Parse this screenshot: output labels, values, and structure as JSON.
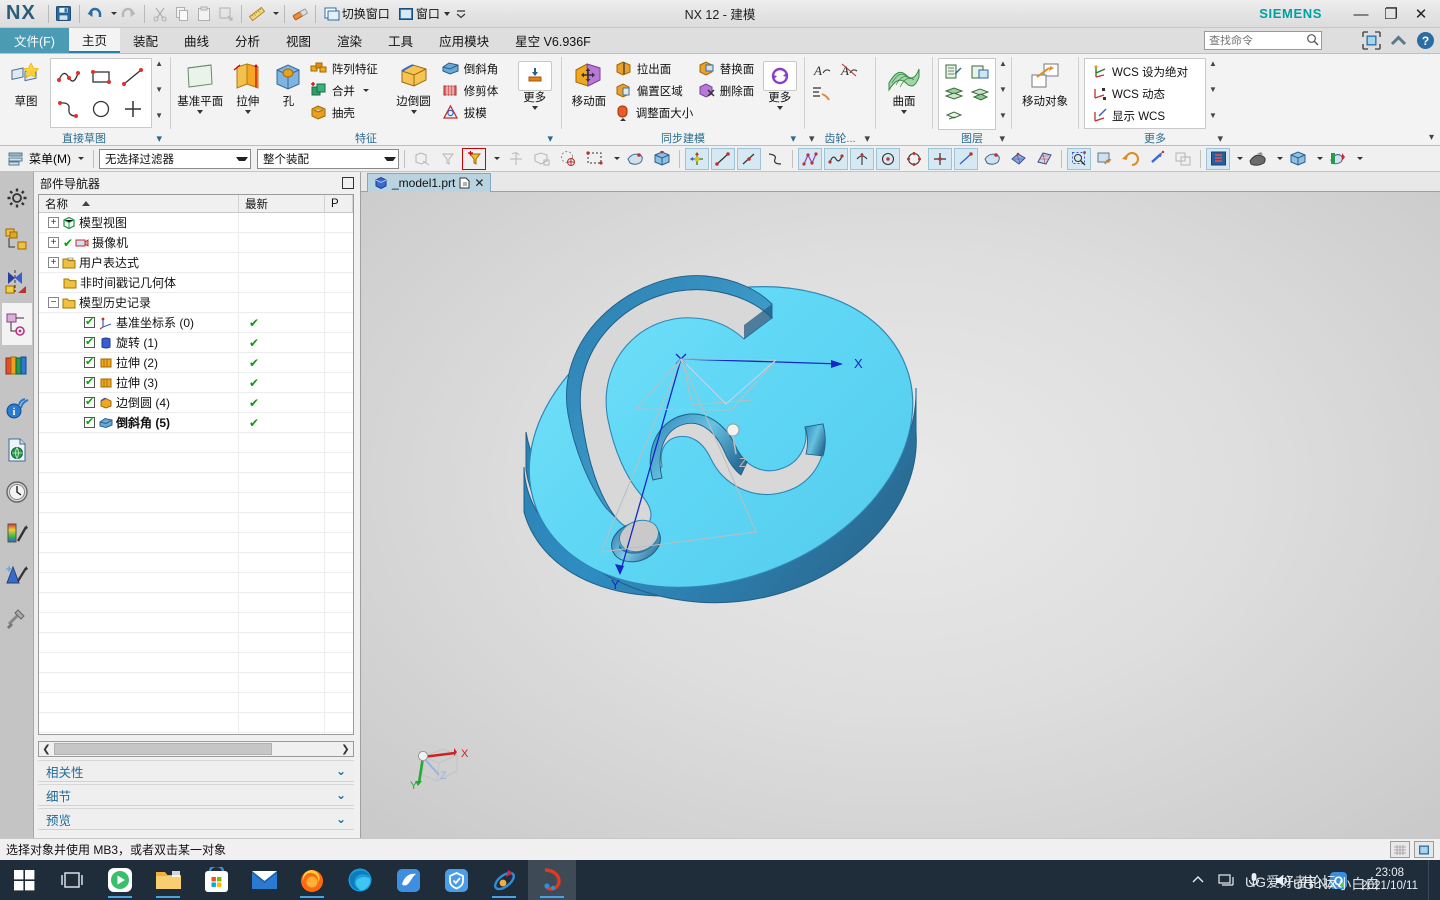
{
  "window": {
    "app_name": "NX",
    "title": "NX 12 - 建模",
    "brand": "SIEMENS",
    "minimize": "—",
    "restore": "❐",
    "close": "✕"
  },
  "quick_access": {
    "items": [
      {
        "name": "save-icon",
        "label": ""
      },
      {
        "name": "undo-icon",
        "label": ""
      },
      {
        "name": "redo-icon",
        "label": ""
      },
      {
        "name": "cut-icon",
        "label": ""
      },
      {
        "name": "copy-icon",
        "label": ""
      },
      {
        "name": "paste-icon",
        "label": ""
      },
      {
        "name": "paste-special-icon",
        "label": ""
      },
      {
        "name": "measure-icon",
        "label": ""
      },
      {
        "name": "eraser-icon",
        "label": ""
      }
    ],
    "switch_window": "切换窗口",
    "window_menu": "窗口"
  },
  "ribbon_tabs": [
    {
      "label": "文件(F)",
      "id": "file"
    },
    {
      "label": "主页",
      "id": "home"
    },
    {
      "label": "装配",
      "id": "assembly"
    },
    {
      "label": "曲线",
      "id": "curve"
    },
    {
      "label": "分析",
      "id": "analysis"
    },
    {
      "label": "视图",
      "id": "view"
    },
    {
      "label": "渲染",
      "id": "render"
    },
    {
      "label": "工具",
      "id": "tools"
    },
    {
      "label": "应用模块",
      "id": "applications"
    },
    {
      "label": "星空 V6.936F",
      "id": "xingkong"
    }
  ],
  "active_tab": "主页",
  "search": {
    "placeholder": "查找命令",
    "value": ""
  },
  "ribbon_groups": [
    {
      "name": "直接草图",
      "label": "直接草图",
      "big_buttons": [
        {
          "label": "草图",
          "icon": "sketch-icon"
        }
      ],
      "gallery": [
        "arc-icon",
        "rectangle-icon",
        "line-icon",
        "spline-icon",
        "circle-icon",
        "point-icon"
      ]
    },
    {
      "name": "特征",
      "label": "特征",
      "big_buttons": [
        {
          "label": "基准平面",
          "icon": "datum-plane-icon",
          "dropdown": true
        },
        {
          "label": "拉伸",
          "icon": "extrude-icon",
          "dropdown": true
        },
        {
          "label": "孔",
          "icon": "hole-icon",
          "dropdown": false
        },
        {
          "label": "边倒圆",
          "icon": "edge-blend-icon",
          "dropdown": true
        },
        {
          "label": "更多",
          "icon": "more-features-icon",
          "dropdown": true
        }
      ],
      "small_buttons": [
        {
          "label": "阵列特征",
          "icon": "pattern-feature-icon"
        },
        {
          "label": "合并",
          "icon": "unite-icon",
          "dropdown": true
        },
        {
          "label": "抽壳",
          "icon": "shell-icon"
        },
        {
          "label": "倒斜角",
          "icon": "chamfer-icon"
        },
        {
          "label": "修剪体",
          "icon": "trim-body-icon"
        },
        {
          "label": "拔模",
          "icon": "draft-icon"
        }
      ]
    },
    {
      "name": "同步建模",
      "label": "同步建模",
      "big_buttons": [
        {
          "label": "移动面",
          "icon": "move-face-icon"
        },
        {
          "label": "更多",
          "icon": "sync-more-icon",
          "dropdown": true
        }
      ],
      "small_buttons": [
        {
          "label": "拉出面",
          "icon": "pull-face-icon"
        },
        {
          "label": "偏置区域",
          "icon": "offset-region-icon"
        },
        {
          "label": "调整面大小",
          "icon": "resize-face-icon"
        },
        {
          "label": "替换面",
          "icon": "replace-face-icon"
        },
        {
          "label": "删除面",
          "icon": "delete-face-icon"
        }
      ]
    },
    {
      "name": "齿轮",
      "label": "齿轮...",
      "small_buttons": [
        {
          "label": "",
          "icon": "gear-a-icon"
        },
        {
          "label": "",
          "icon": "gear-b-icon"
        },
        {
          "label": "",
          "icon": "gear-c-icon"
        }
      ]
    },
    {
      "name": "曲面",
      "label": "",
      "big_buttons": [
        {
          "label": "曲面",
          "icon": "surface-icon",
          "dropdown": true
        }
      ]
    },
    {
      "name": "图层",
      "label": "图层",
      "gallery": [
        "layer-settings-icon",
        "layer-visible-icon",
        "move-to-layer-icon",
        "copy-to-layer-icon",
        "layer-category-icon"
      ]
    },
    {
      "name": "移动对象",
      "label": "",
      "big_buttons": [
        {
          "label": "移动对象",
          "icon": "move-object-icon"
        }
      ]
    },
    {
      "name": "更多",
      "label": "更多",
      "small_buttons": [
        {
          "label": "WCS 设为绝对",
          "icon": "wcs-absolute-icon"
        },
        {
          "label": "WCS 动态",
          "icon": "wcs-dynamic-icon"
        },
        {
          "label": "显示 WCS",
          "icon": "wcs-display-icon"
        }
      ]
    }
  ],
  "selection_bar": {
    "menu_label": "菜单(M)",
    "filter_value": "无选择过滤器",
    "scope_value": "整个装配",
    "filter_options": [
      "无选择过滤器"
    ],
    "scope_options": [
      "整个装配"
    ]
  },
  "left_rail": [
    {
      "name": "rail-item-settings",
      "icon": "gear-icon"
    },
    {
      "name": "rail-item-assembly-navigator",
      "icon": "assembly-navigator-icon"
    },
    {
      "name": "rail-item-constraint-navigator",
      "icon": "constraint-navigator-icon"
    },
    {
      "name": "rail-item-part-navigator",
      "icon": "part-navigator-icon",
      "active": true
    },
    {
      "name": "rail-item-reuse-library",
      "icon": "reuse-library-icon"
    },
    {
      "name": "rail-item-web-browser",
      "icon": "info-browser-icon"
    },
    {
      "name": "rail-item-html-help",
      "icon": "html-help-icon"
    },
    {
      "name": "rail-item-history",
      "icon": "history-clock-icon"
    },
    {
      "name": "rail-item-system-materials",
      "icon": "materials-icon"
    },
    {
      "name": "rail-item-system-scenes",
      "icon": "scenes-icon"
    },
    {
      "name": "rail-item-system-visualization",
      "icon": "tools-hammer-icon"
    }
  ],
  "part_navigator": {
    "title": "部件导航器",
    "columns": [
      "名称",
      "最新",
      "P"
    ],
    "rows": [
      {
        "label": "模型视图",
        "indent": 0,
        "expander": "+",
        "icon": "model-views-icon",
        "checkbox": false,
        "status": "",
        "bold": false
      },
      {
        "label": "摄像机",
        "indent": 0,
        "expander": "+",
        "icon": "cameras-icon",
        "checkbox": false,
        "status": "✔",
        "inline_check": true,
        "bold": false
      },
      {
        "label": "用户表达式",
        "indent": 0,
        "expander": "+",
        "icon": "folder-icon",
        "checkbox": false,
        "status": "",
        "bold": false
      },
      {
        "label": "非时间戳记几何体",
        "indent": 0,
        "expander": "",
        "icon": "folder-icon",
        "checkbox": false,
        "status": "",
        "bold": false
      },
      {
        "label": "模型历史记录",
        "indent": 0,
        "expander": "-",
        "icon": "folder-icon",
        "checkbox": false,
        "status": "",
        "bold": false
      },
      {
        "label": "基准坐标系 (0)",
        "indent": 1,
        "expander": "",
        "icon": "datum-csys-icon",
        "checkbox": true,
        "status": "✔",
        "bold": false
      },
      {
        "label": "旋转 (1)",
        "indent": 1,
        "expander": "",
        "icon": "revolve-icon",
        "checkbox": true,
        "status": "✔",
        "bold": false
      },
      {
        "label": "拉伸 (2)",
        "indent": 1,
        "expander": "",
        "icon": "extrude-feature-icon",
        "checkbox": true,
        "status": "✔",
        "bold": false
      },
      {
        "label": "拉伸 (3)",
        "indent": 1,
        "expander": "",
        "icon": "extrude-feature-icon",
        "checkbox": true,
        "status": "✔",
        "bold": false
      },
      {
        "label": "边倒圆 (4)",
        "indent": 1,
        "expander": "",
        "icon": "edge-blend-feature-icon",
        "checkbox": true,
        "status": "✔",
        "bold": false
      },
      {
        "label": "倒斜角 (5)",
        "indent": 1,
        "expander": "",
        "icon": "chamfer-feature-icon",
        "checkbox": true,
        "status": "✔",
        "bold": true
      }
    ],
    "bottom_panels": [
      {
        "label": "相关性",
        "chevron": "⌄"
      },
      {
        "label": "细节",
        "chevron": "⌄"
      },
      {
        "label": "预览",
        "chevron": "⌄"
      }
    ]
  },
  "document_tab": {
    "label": "_model1.prt",
    "modified_icon": "modified-icon",
    "close_icon": "✕"
  },
  "viewport": {
    "triad": {
      "x_label": "X",
      "y_label": "Y",
      "z_label": "Z"
    },
    "wcs": {
      "x_label": "X",
      "y_label": "Y",
      "z_label": "Z"
    },
    "model_color": "#5fd7f5",
    "model_side_color": "#2e86b5",
    "background_top": "#e9e9e9",
    "background_bottom": "#c9c9c9"
  },
  "status_bar": {
    "message": "选择对象并使用 MB3，或者双击某一对象"
  },
  "taskbar": {
    "items": [
      {
        "name": "start-button",
        "icon": "windows-icon"
      },
      {
        "name": "task-view-button",
        "icon": "task-view-icon"
      },
      {
        "name": "taskbar-potplayer",
        "icon": "media-player-icon"
      },
      {
        "name": "taskbar-file-explorer",
        "icon": "folder-icon",
        "running": true
      },
      {
        "name": "taskbar-microsoft-store",
        "icon": "store-icon"
      },
      {
        "name": "taskbar-mail",
        "icon": "mail-icon"
      },
      {
        "name": "taskbar-firefox",
        "icon": "firefox-icon",
        "running": true
      },
      {
        "name": "taskbar-edge",
        "icon": "edge-icon"
      },
      {
        "name": "taskbar-foxmail",
        "icon": "bird-icon"
      },
      {
        "name": "taskbar-security",
        "icon": "shield-icon"
      },
      {
        "name": "taskbar-browser",
        "icon": "comet-icon",
        "running": true
      },
      {
        "name": "taskbar-nx",
        "icon": "nx-app-icon",
        "running": true,
        "active": true
      }
    ],
    "tray": [
      {
        "name": "tray-show-hidden",
        "glyph": "⌃"
      },
      {
        "name": "tray-network",
        "glyph": "🖥"
      },
      {
        "name": "tray-microphone",
        "glyph": "🎤"
      },
      {
        "name": "tray-volume",
        "glyph": "🔊"
      },
      {
        "name": "tray-ime",
        "glyph": "中"
      },
      {
        "name": "tray-qq",
        "glyph": "Q"
      }
    ],
    "clock_time": "23:08",
    "clock_date": "2021/10/11"
  },
  "watermark": {
    "line1": "UG爱好者论坛",
    "line2": "UG NX小白白"
  }
}
